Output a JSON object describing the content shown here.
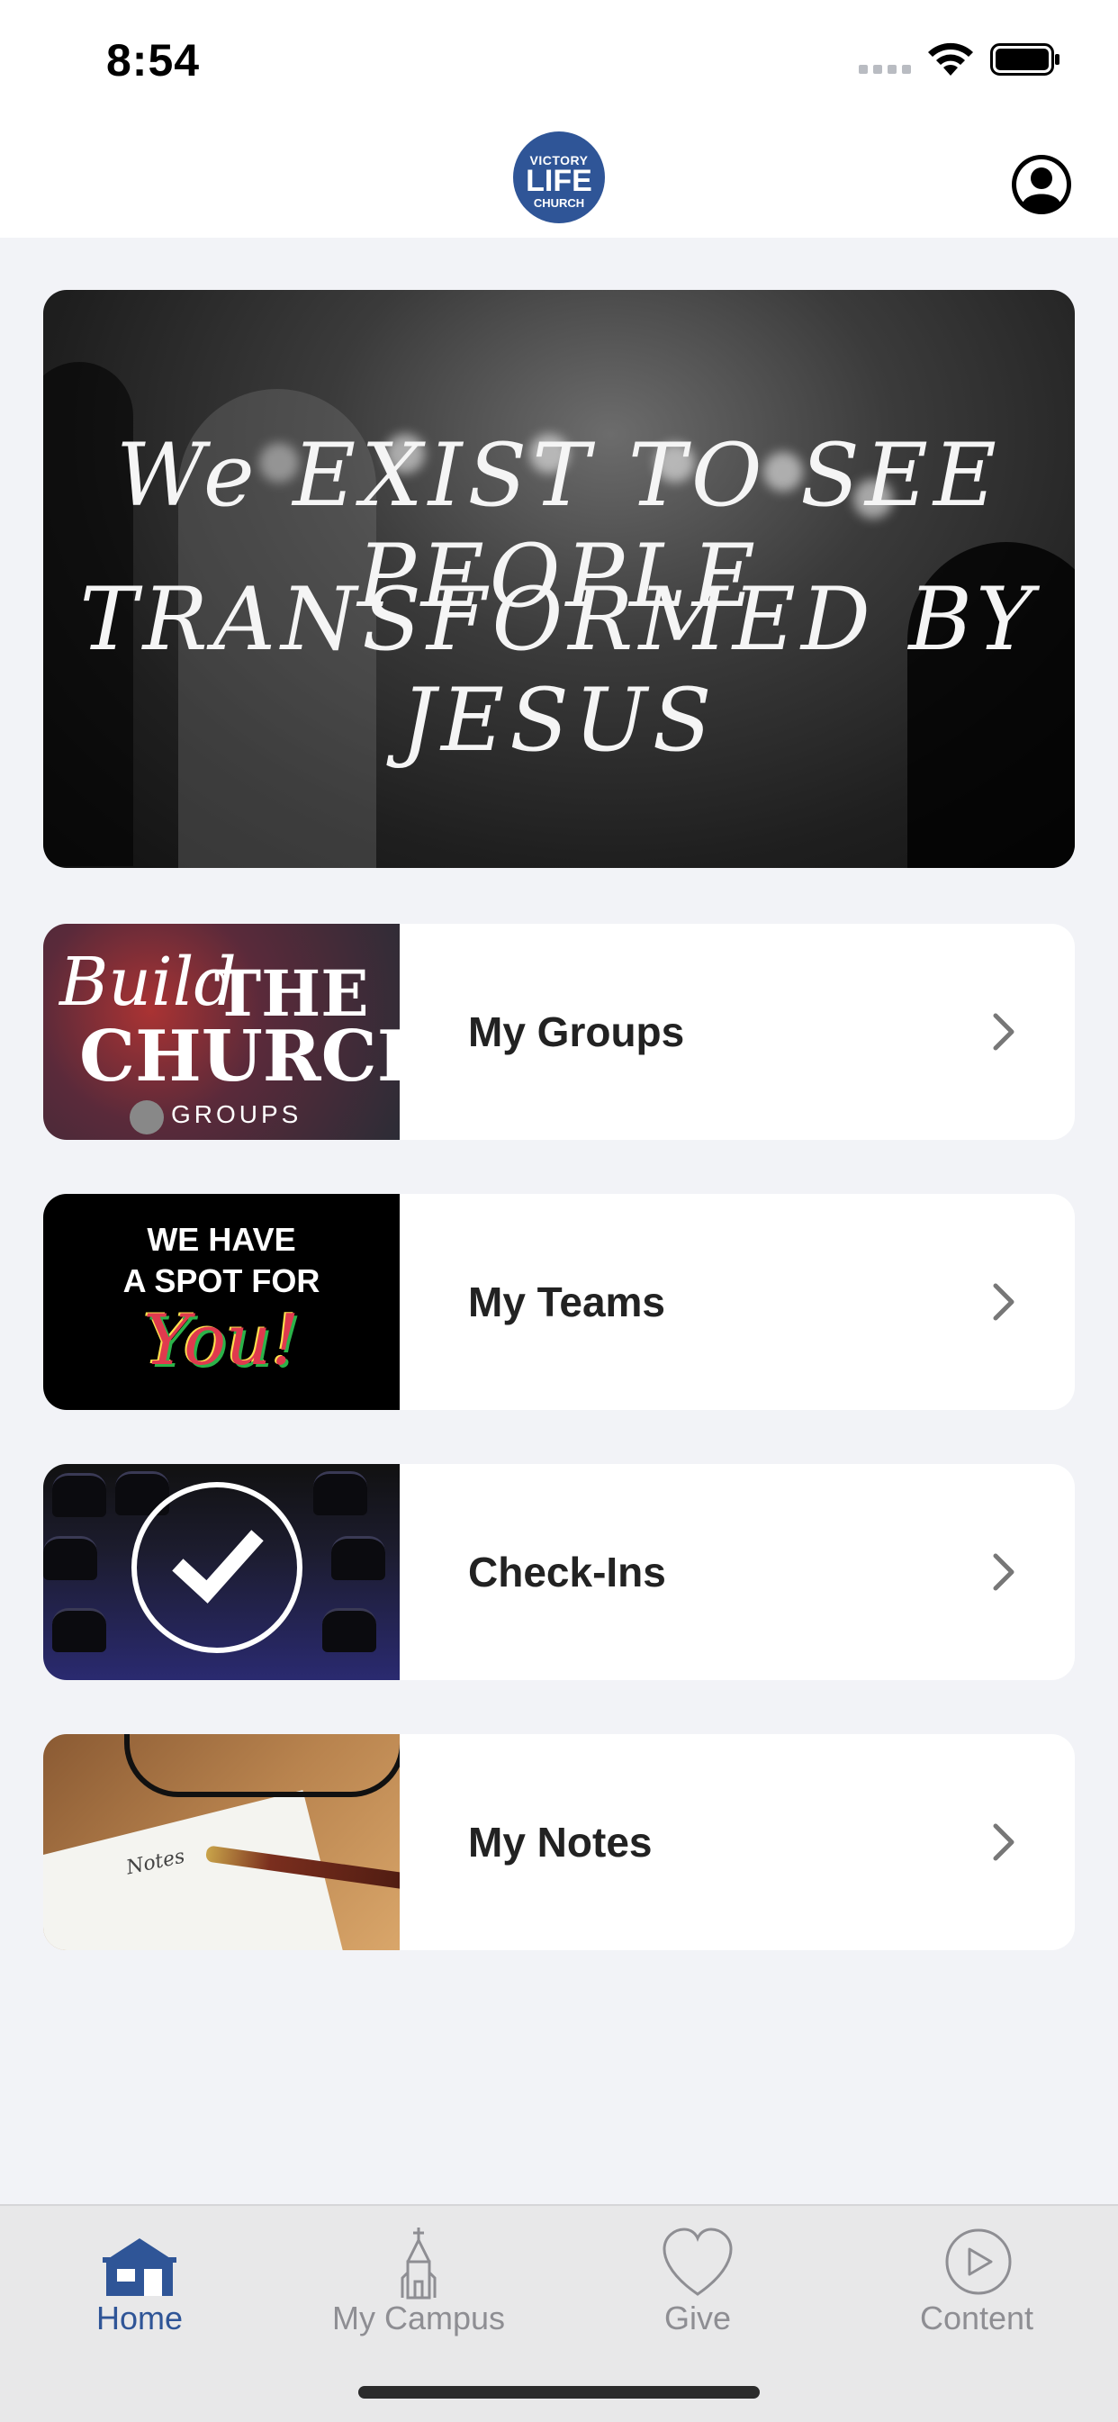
{
  "status_bar": {
    "time": "8:54"
  },
  "header": {
    "logo_line1": "VICTORY",
    "logo_line2": "LIFE",
    "logo_line3": "CHURCH",
    "profile_icon": "person-circle-icon"
  },
  "hero": {
    "line1": "We EXIST TO SEE PEOPLE",
    "line2": "TRANSFORMED BY JESUS"
  },
  "cards": [
    {
      "label": "My Groups",
      "thumb_text": [
        "Build",
        "THE",
        "CHURCH",
        "GROUPS"
      ]
    },
    {
      "label": "My Teams",
      "thumb_text": [
        "WE HAVE",
        "A SPOT FOR",
        "You!"
      ]
    },
    {
      "label": "Check-Ins"
    },
    {
      "label": "My Notes",
      "thumb_text": [
        "Notes"
      ]
    }
  ],
  "tabs": [
    {
      "label": "Home",
      "icon": "house-icon",
      "active": true
    },
    {
      "label": "My Campus",
      "icon": "church-icon",
      "active": false
    },
    {
      "label": "Give",
      "icon": "heart-icon",
      "active": false
    },
    {
      "label": "Content",
      "icon": "play-circle-icon",
      "active": false
    }
  ],
  "colors": {
    "accent": "#2f5597",
    "inactive": "#8e8e93",
    "background": "#f2f3f7"
  }
}
